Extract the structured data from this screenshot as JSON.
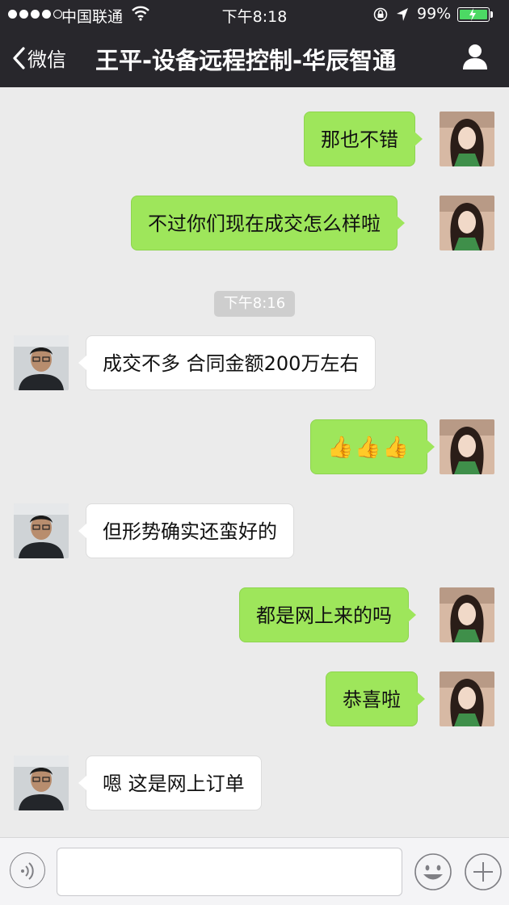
{
  "status": {
    "carrier": "中国联通",
    "time": "下午8:18",
    "battery": "99%",
    "battery_level": 0.99
  },
  "nav": {
    "back_label": "微信",
    "title": "王平-设备远程控制-华辰智通"
  },
  "messages": [
    {
      "side": "right",
      "text": "那也不错"
    },
    {
      "side": "right",
      "text": "不过你们现在成交怎么样啦"
    },
    {
      "side": "left",
      "text": "成交不多 合同金额200万左右"
    },
    {
      "side": "right",
      "text": "👍👍👍"
    },
    {
      "side": "left",
      "text": "但形势确实还蛮好的"
    },
    {
      "side": "right",
      "text": "都是网上来的吗"
    },
    {
      "side": "right",
      "text": "恭喜啦"
    },
    {
      "side": "left",
      "text": "嗯 这是网上订单"
    }
  ],
  "timestamp": "下午8:16",
  "input": {
    "value": ""
  }
}
